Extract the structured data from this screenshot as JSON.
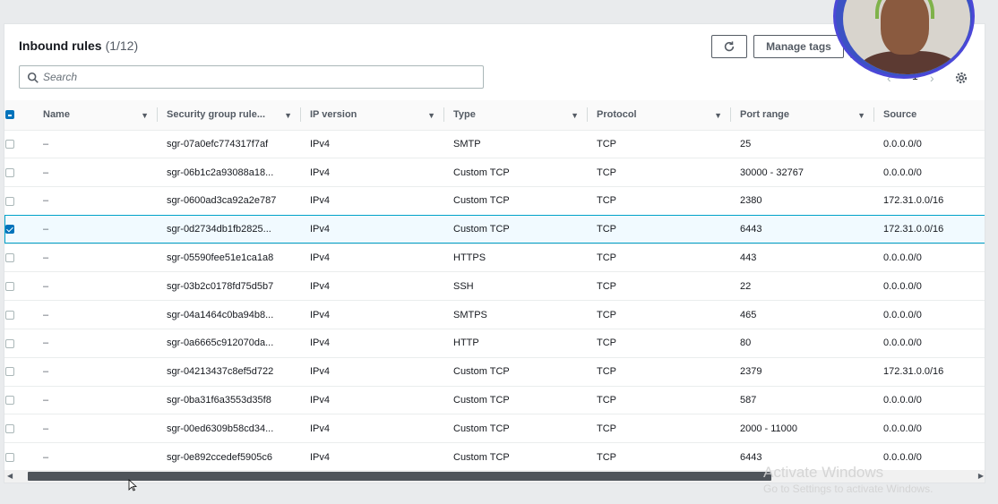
{
  "header": {
    "title": "Inbound rules",
    "count": "(1/12)",
    "refresh_icon": "refresh-icon",
    "manage_tags_label": "Manage tags"
  },
  "search": {
    "placeholder": "Search",
    "value": ""
  },
  "pagination": {
    "current_page": "1",
    "prev_icon": "chevron-left-icon",
    "next_icon": "chevron-right-icon"
  },
  "columns": [
    "Name",
    "Security group rule...",
    "IP version",
    "Type",
    "Protocol",
    "Port range",
    "Source"
  ],
  "rows": [
    {
      "name": "–",
      "rule_id": "sgr-07a0efc774317f7af",
      "ip_version": "IPv4",
      "type": "SMTP",
      "protocol": "TCP",
      "port_range": "25",
      "source": "0.0.0.0/0",
      "selected": false
    },
    {
      "name": "–",
      "rule_id": "sgr-06b1c2a93088a18...",
      "ip_version": "IPv4",
      "type": "Custom TCP",
      "protocol": "TCP",
      "port_range": "30000 - 32767",
      "source": "0.0.0.0/0",
      "selected": false
    },
    {
      "name": "–",
      "rule_id": "sgr-0600ad3ca92a2e787",
      "ip_version": "IPv4",
      "type": "Custom TCP",
      "protocol": "TCP",
      "port_range": "2380",
      "source": "172.31.0.0/16",
      "selected": false
    },
    {
      "name": "–",
      "rule_id": "sgr-0d2734db1fb2825...",
      "ip_version": "IPv4",
      "type": "Custom TCP",
      "protocol": "TCP",
      "port_range": "6443",
      "source": "172.31.0.0/16",
      "selected": true
    },
    {
      "name": "–",
      "rule_id": "sgr-05590fee51e1ca1a8",
      "ip_version": "IPv4",
      "type": "HTTPS",
      "protocol": "TCP",
      "port_range": "443",
      "source": "0.0.0.0/0",
      "selected": false
    },
    {
      "name": "–",
      "rule_id": "sgr-03b2c0178fd75d5b7",
      "ip_version": "IPv4",
      "type": "SSH",
      "protocol": "TCP",
      "port_range": "22",
      "source": "0.0.0.0/0",
      "selected": false
    },
    {
      "name": "–",
      "rule_id": "sgr-04a1464c0ba94b8...",
      "ip_version": "IPv4",
      "type": "SMTPS",
      "protocol": "TCP",
      "port_range": "465",
      "source": "0.0.0.0/0",
      "selected": false
    },
    {
      "name": "–",
      "rule_id": "sgr-0a6665c912070da...",
      "ip_version": "IPv4",
      "type": "HTTP",
      "protocol": "TCP",
      "port_range": "80",
      "source": "0.0.0.0/0",
      "selected": false
    },
    {
      "name": "–",
      "rule_id": "sgr-04213437c8ef5d722",
      "ip_version": "IPv4",
      "type": "Custom TCP",
      "protocol": "TCP",
      "port_range": "2379",
      "source": "172.31.0.0/16",
      "selected": false
    },
    {
      "name": "–",
      "rule_id": "sgr-0ba31f6a3553d35f8",
      "ip_version": "IPv4",
      "type": "Custom TCP",
      "protocol": "TCP",
      "port_range": "587",
      "source": "0.0.0.0/0",
      "selected": false
    },
    {
      "name": "–",
      "rule_id": "sgr-00ed6309b58cd34...",
      "ip_version": "IPv4",
      "type": "Custom TCP",
      "protocol": "TCP",
      "port_range": "2000 - 11000",
      "source": "0.0.0.0/0",
      "selected": false
    },
    {
      "name": "–",
      "rule_id": "sgr-0e892ccedef5905c6",
      "ip_version": "IPv4",
      "type": "Custom TCP",
      "protocol": "TCP",
      "port_range": "6443",
      "source": "0.0.0.0/0",
      "selected": false
    }
  ],
  "watermark": {
    "line1": "Activate Windows",
    "line2": "Go to Settings to activate Windows."
  },
  "colors": {
    "accent": "#0073bb",
    "selected_row_bg": "#f1faff",
    "selected_row_border": "#00a1c9"
  }
}
